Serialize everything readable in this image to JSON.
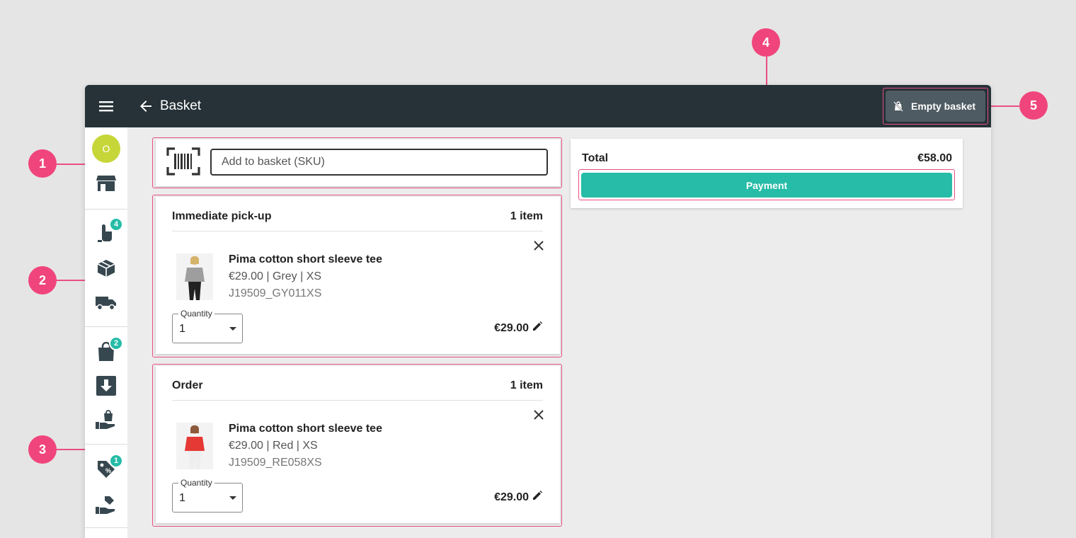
{
  "topbar": {
    "title": "Basket",
    "empty_basket_label": "Empty basket"
  },
  "sidebar": {
    "avatar_initial": "O",
    "badges": {
      "touch": "4",
      "bag": "2",
      "tag": "1"
    }
  },
  "scan": {
    "placeholder": "Add to basket (SKU)"
  },
  "sections": [
    {
      "title": "Immediate pick-up",
      "count": "1 item",
      "product": {
        "name": "Pima cotton short sleeve tee",
        "meta": "€29.00 | Grey | XS",
        "sku": "J19509_GY011XS",
        "shirt_color": "#9e9e9e",
        "quantity_label": "Quantity",
        "quantity": "1",
        "line_price": "€29.00"
      }
    },
    {
      "title": "Order",
      "count": "1 item",
      "product": {
        "name": "Pima cotton short sleeve tee",
        "meta": "€29.00 | Red | XS",
        "sku": "J19509_RE058XS",
        "shirt_color": "#e53935",
        "quantity_label": "Quantity",
        "quantity": "1",
        "line_price": "€29.00"
      }
    }
  ],
  "summary": {
    "total_label": "Total",
    "total_value": "€58.00",
    "payment_label": "Payment"
  },
  "callouts": [
    "1",
    "2",
    "3",
    "4",
    "5"
  ],
  "colors": {
    "topbar": "#263238",
    "accent": "#26bca7",
    "highlight": "#ea4f86",
    "callout": "#f0457c",
    "avatar": "#c6d639"
  }
}
